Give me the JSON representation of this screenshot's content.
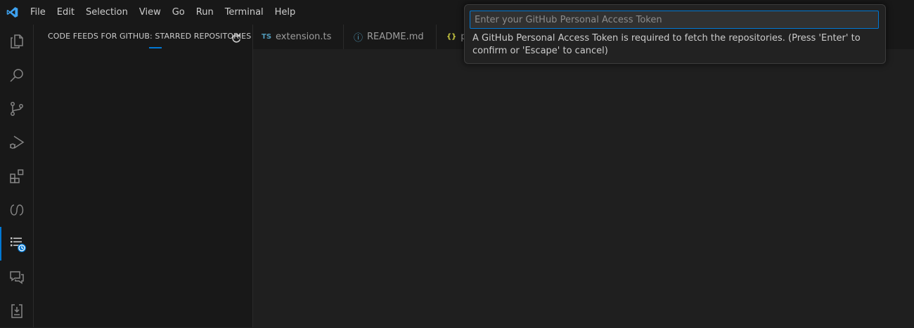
{
  "titlebar": {
    "menu": [
      "File",
      "Edit",
      "Selection",
      "View",
      "Go",
      "Run",
      "Terminal",
      "Help"
    ],
    "accent_color": "#0078d4"
  },
  "activitybar": {
    "items": [
      {
        "icon": "explorer-icon"
      },
      {
        "icon": "search-icon"
      },
      {
        "icon": "source-control-icon"
      },
      {
        "icon": "run-debug-icon"
      },
      {
        "icon": "extensions-icon"
      },
      {
        "icon": "copilot-icon"
      },
      {
        "icon": "code-feeds-icon",
        "active": true
      },
      {
        "icon": "chat-icon"
      },
      {
        "icon": "testing-icon"
      }
    ]
  },
  "sidebar": {
    "title": "CODE FEEDS FOR GITHUB: STARRED REPOSITORIES",
    "refresh_icon": "refresh-icon"
  },
  "tabs": [
    {
      "icon_text": "TS",
      "icon_color": "#519aba",
      "label": "extension.ts"
    },
    {
      "icon_text": "ⓘ",
      "icon_color": "#519aba",
      "label": "README.md"
    },
    {
      "icon_text": "{}",
      "icon_color": "#cbcb41",
      "label": "p"
    }
  ],
  "quick_input": {
    "value": "",
    "placeholder": "Enter your GitHub Personal Access Token",
    "message": "A GitHub Personal Access Token is required to fetch the repositories. (Press 'Enter' to confirm or 'Escape' to cancel)"
  }
}
